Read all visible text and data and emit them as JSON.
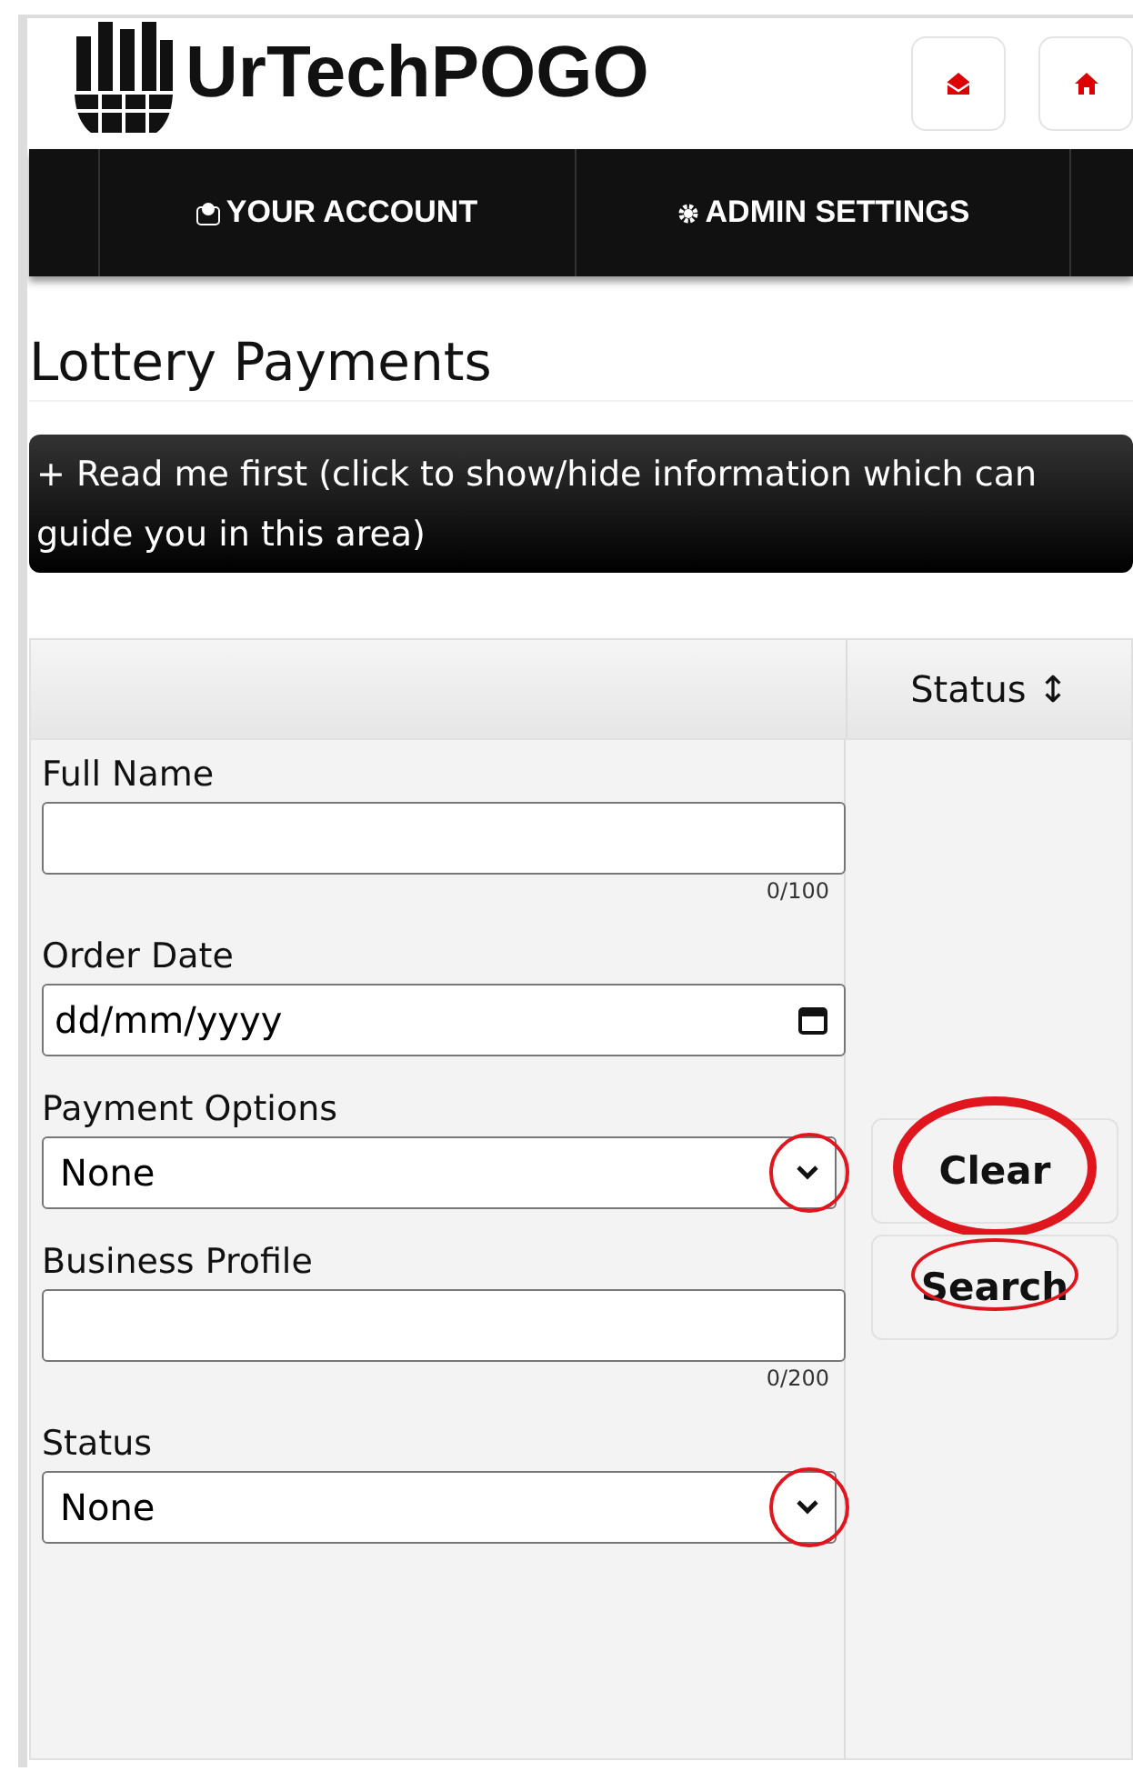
{
  "header": {
    "logo_text": "UrTechPOGO",
    "icon_buttons": [
      {
        "kind": "mail"
      },
      {
        "kind": "home"
      }
    ]
  },
  "nav": [
    {
      "kind": "account",
      "label": "YOUR ACCOUNT"
    },
    {
      "kind": "settings",
      "label": "ADMIN SETTINGS"
    }
  ],
  "page_title": "Lottery Payments",
  "info_bar": "+ Read me first (click to show/hide information which can guide you in this area)",
  "table": {
    "columns": [
      "",
      "Status ↕"
    ]
  },
  "filters": [
    {
      "kind": "text",
      "label": "Full Name",
      "value_counter": "0/100"
    },
    {
      "kind": "date",
      "label": "Order Date",
      "placeholder": "dd/mm/yyyy"
    },
    {
      "kind": "select",
      "label": "Payment Options",
      "value": "None",
      "highlighted": true
    },
    {
      "kind": "text",
      "label": "Business Profile",
      "value_counter": "0/200"
    },
    {
      "kind": "select",
      "label": "Status",
      "value": "None",
      "highlighted": true
    }
  ],
  "buttons": [
    {
      "label": "Clear",
      "highlighted": true
    },
    {
      "label": "Search",
      "highlighted": true
    }
  ]
}
